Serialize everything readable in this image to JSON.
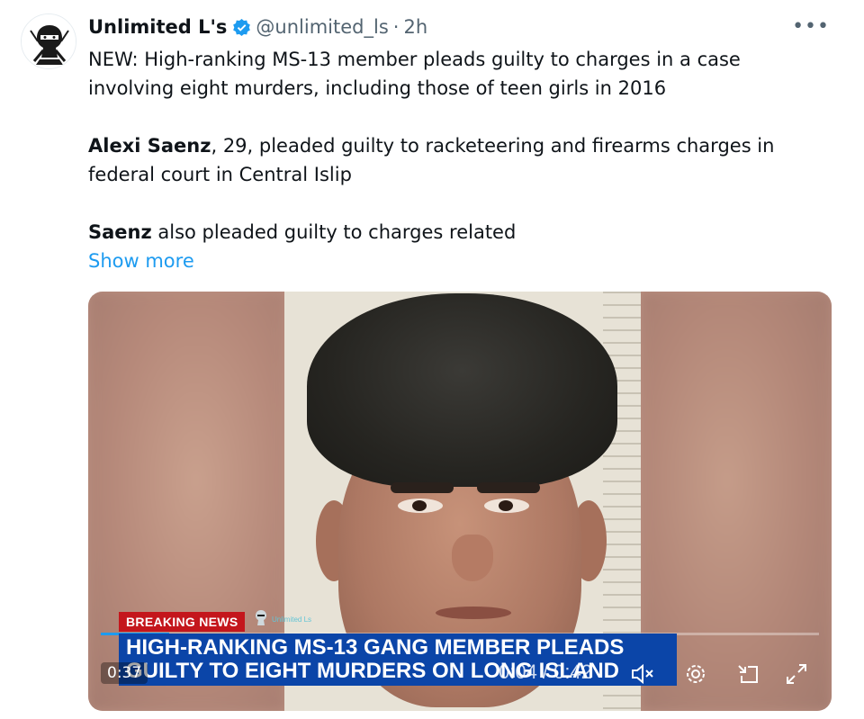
{
  "tweet": {
    "author_name": "Unlimited L's",
    "handle": "@unlimited_ls",
    "separator": "·",
    "time": "2h",
    "more_label": "•••",
    "paragraph1": "NEW: High-ranking MS-13 member pleads guilty to charges in a case involving eight murders, including those of teen girls in 2016",
    "paragraph2_bold": "Alexi Saenz",
    "paragraph2_rest": ", 29, pleaded guilty to racketeering and firearms charges in federal court in Central Islip",
    "paragraph3_bold": "Saenz",
    "paragraph3_rest": " also pleaded guilty to charges related",
    "show_more": "Show more"
  },
  "video": {
    "breaking_label": "BREAKING NEWS",
    "watermark_text": "Unlimited Ls",
    "headline_line1": "HIGH-RANKING MS-13 GANG MEMBER PLEADS",
    "headline_line2": "GUILTY TO EIGHT MURDERS ON LONG ISLAND",
    "remaining_time": "0:37",
    "position_time": "0:04 / 0:42",
    "progress_fraction": 0.095,
    "icons": [
      "mute-icon",
      "settings-icon",
      "picture-in-picture-icon",
      "fullscreen-icon"
    ]
  },
  "colors": {
    "verified": "#1d9bf0",
    "link": "#1d9bf0",
    "breaking": "#c4161c",
    "headline_bg": "#0b45a8"
  }
}
